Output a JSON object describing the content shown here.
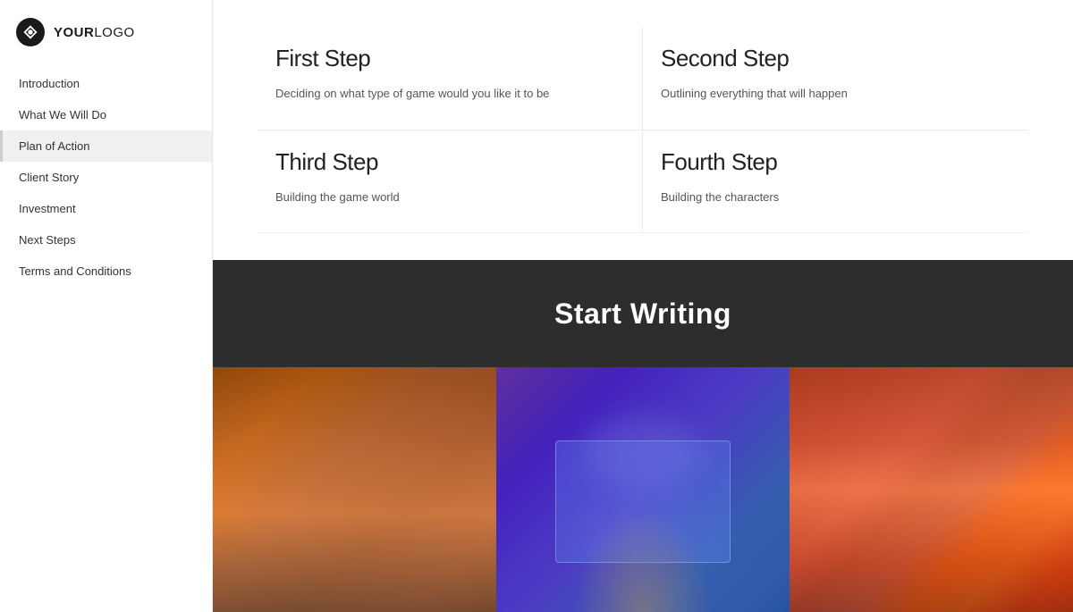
{
  "logo": {
    "text_bold": "YOUR",
    "text_light": "LOGO"
  },
  "sidebar": {
    "items": [
      {
        "label": "Introduction",
        "active": false
      },
      {
        "label": "What We Will Do",
        "active": false
      },
      {
        "label": "Plan of Action",
        "active": true
      },
      {
        "label": "Client Story",
        "active": false
      },
      {
        "label": "Investment",
        "active": false
      },
      {
        "label": "Next Steps",
        "active": false
      },
      {
        "label": "Terms and Conditions",
        "active": false
      }
    ]
  },
  "steps": [
    {
      "title": "First Step",
      "description": "Deciding on what type of game would you like it to be"
    },
    {
      "title": "Second Step",
      "description": "Outlining everything that will happen"
    },
    {
      "title": "Third Step",
      "description": "Building the game world"
    },
    {
      "title": "Fourth Step",
      "description": "Building the characters"
    }
  ],
  "cta": {
    "title": "Start Writing"
  }
}
